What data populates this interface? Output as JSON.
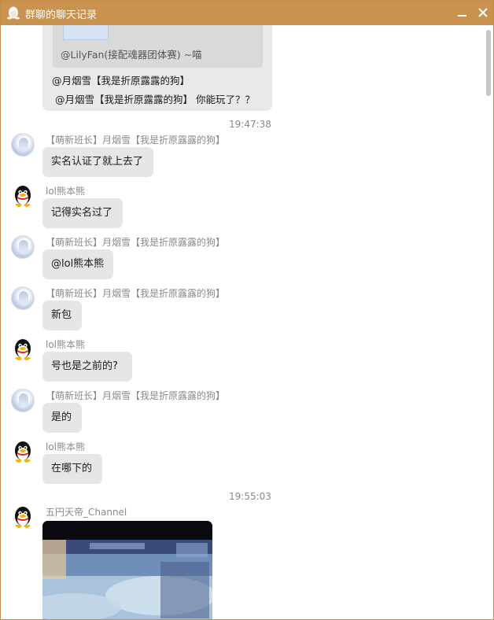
{
  "window": {
    "title": "群聊的聊天记录",
    "accent_color": "#c9924f"
  },
  "top_bubble": {
    "quote_author": "@LilyFan(接配魂器团体赛) ~喵",
    "lines": [
      "@月烟雪【我是折原露露的狗】",
      "@月烟雪【我是折原露露的狗】 你能玩了？？"
    ]
  },
  "timestamps": [
    "19:47:38",
    "19:55:03"
  ],
  "messages": [
    {
      "sender": "【萌新班长】月烟雪【我是折原露露的狗】",
      "avatar": "anime-avatar",
      "text": "实名认证了就上去了"
    },
    {
      "sender": "lol熊本熊",
      "avatar": "qq-penguin-avatar",
      "text": "记得实名过了"
    },
    {
      "sender": "【萌新班长】月烟雪【我是折原露露的狗】",
      "avatar": "anime-avatar",
      "text": "@lol熊本熊"
    },
    {
      "sender": "【萌新班长】月烟雪【我是折原露露的狗】",
      "avatar": "anime-avatar",
      "text": "新包"
    },
    {
      "sender": "lol熊本熊",
      "avatar": "qq-penguin-avatar",
      "text": "号也是之前的?"
    },
    {
      "sender": "【萌新班长】月烟雪【我是折原露露的狗】",
      "avatar": "anime-avatar",
      "text": "是的"
    },
    {
      "sender": "lol熊本熊",
      "avatar": "qq-penguin-avatar",
      "text": "在哪下的"
    }
  ],
  "last_message": {
    "sender": "五円天帝_Channel",
    "avatar": "qq-penguin-avatar",
    "attachment": "game-screenshot-image"
  },
  "icons": {
    "minimize": "minimize-icon",
    "close": "close-icon",
    "app": "qq-penguin-icon"
  }
}
